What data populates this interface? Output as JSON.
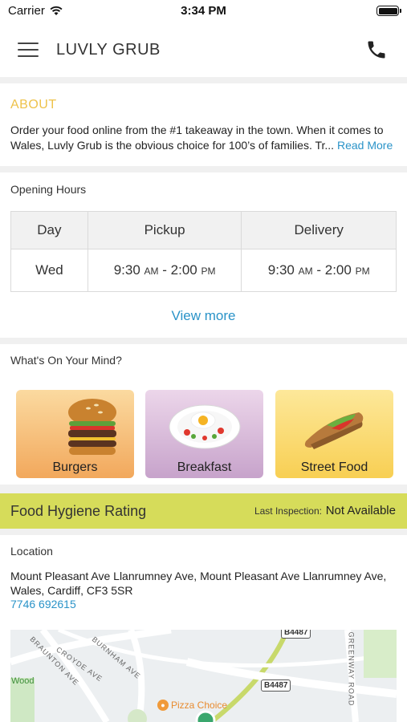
{
  "status_bar": {
    "carrier": "Carrier",
    "time": "3:34 PM",
    "icons": [
      "wifi-icon",
      "battery-icon"
    ]
  },
  "navbar": {
    "title": "LUVLY GRUB",
    "menu_icon": "hamburger-menu-icon",
    "call_icon": "phone-icon"
  },
  "about": {
    "title": "ABOUT",
    "text": "Order your food online from the #1 takeaway in the town. When it comes to Wales, Luvly Grub is the obvious choice for 100’s of families. Tr...",
    "read_more": "Read More"
  },
  "opening_hours": {
    "label": "Opening Hours",
    "headers": [
      "Day",
      "Pickup",
      "Delivery"
    ],
    "rows": [
      {
        "day": "Wed",
        "pickup": {
          "open": "9:30",
          "open_ampm": "AM",
          "sep": " - ",
          "close": "2:00",
          "close_ampm": "PM"
        },
        "delivery": {
          "open": "9:30",
          "open_ampm": "AM",
          "sep": " - ",
          "close": "2:00",
          "close_ampm": "PM"
        }
      }
    ],
    "view_more": "View more"
  },
  "categories": {
    "label": "What's On Your Mind?",
    "items": [
      {
        "label": "Burgers",
        "icon": "burger-icon"
      },
      {
        "label": "Breakfast",
        "icon": "breakfast-plate-icon"
      },
      {
        "label": "Street Food",
        "icon": "wrap-icon"
      }
    ]
  },
  "hygiene": {
    "title": "Food Hygiene Rating",
    "inspection_label": "Last Inspection:",
    "inspection_value": "Not Available",
    "color": "#d6dc5a"
  },
  "location": {
    "label": "Location",
    "address": "Mount Pleasant Ave Llanrumney Ave, Mount Pleasant Ave Llanrumney Ave, Wales, Cardiff, CF3 5SR",
    "phone": "7746 692615",
    "map": {
      "labels": [
        "BRAUNTON AVE",
        "CROYDE AVE",
        "BURNHAM AVE",
        "GREENWAY ROAD",
        "Wood"
      ],
      "road_shields": [
        "B4487",
        "B4487"
      ],
      "poi": "Pizza Choice"
    }
  },
  "colors": {
    "accent_link": "#2a93c8",
    "about_title": "#eec24a"
  }
}
